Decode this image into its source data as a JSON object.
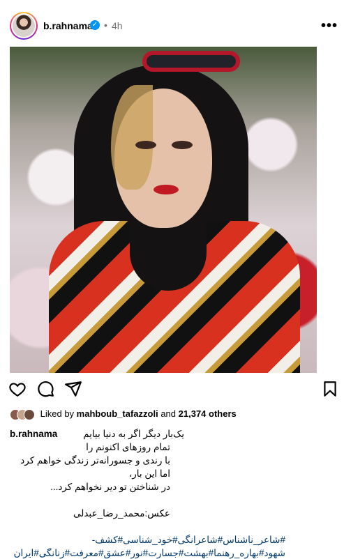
{
  "post": {
    "username": "b.rahnama",
    "verified_mark": "✓",
    "separator": "•",
    "time": "4h",
    "more_label": "•••"
  },
  "actions": {
    "like": "heart-icon",
    "comment": "comment-icon",
    "share": "send-icon",
    "save": "bookmark-icon"
  },
  "likes": {
    "prefix": "Liked by",
    "user": "mahboub_tafazzoli",
    "middle": "and",
    "count": "21,374 others"
  },
  "caption": {
    "username": "b.rahnama",
    "lines": [
      "یک‌بار دیگر اگر به دنیا بیایم",
      "تمام روزهای اکنونم را",
      "با رندی و جسورانه‌تر زندگی خواهم کرد",
      "اما این بار،",
      "در شناختن تو دیر نخواهم کرد..."
    ],
    "photo_credit": "عکس:محمد_رضا_عبدلی",
    "hashtags_line1": "#شاعر_ناشناس#شاعرانگی#خود_شناسی#کشف-",
    "hashtags_line2": "شهود#بهاره_رهنما#بهشت#جسارت#نور#عشق#معرفت#زنانگی#ایران"
  },
  "colors": {
    "verified": "#0095f6",
    "hashtag": "#00376b",
    "muted": "#737373"
  }
}
